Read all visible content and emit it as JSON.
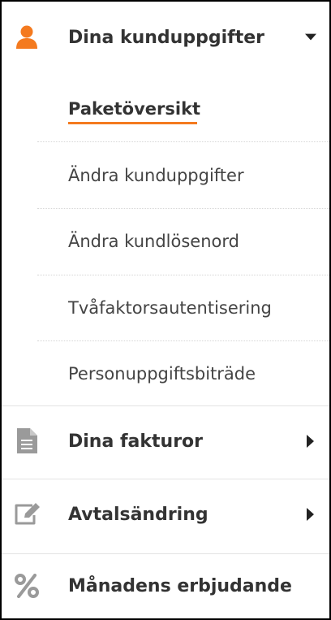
{
  "colors": {
    "accent": "#f47a1f",
    "icon_gray": "#9a9a9a",
    "text": "#333333",
    "border": "#000000"
  },
  "sections": {
    "customer": {
      "label": "Dina kunduppgifter",
      "icon": "user-icon",
      "expanded": true,
      "items": [
        {
          "label": "Paketöversikt",
          "active": true
        },
        {
          "label": "Ändra kunduppgifter"
        },
        {
          "label": "Ändra kundlösenord"
        },
        {
          "label": "Tvåfaktorsautentisering"
        },
        {
          "label": "Personuppgiftsbiträde"
        }
      ]
    },
    "invoices": {
      "label": "Dina fakturor",
      "icon": "document-icon"
    },
    "contract": {
      "label": "Avtalsändring",
      "icon": "edit-icon"
    },
    "offer": {
      "label": "Månadens erbjudande",
      "icon": "percent-icon"
    }
  }
}
